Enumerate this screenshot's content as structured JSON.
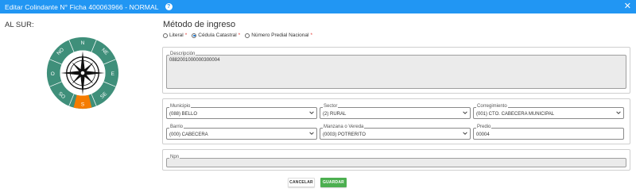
{
  "window": {
    "title": "Editar Colindante N° Ficha 400063966 - NORMAL",
    "help_icon": "?",
    "close_icon": "✕"
  },
  "side": {
    "label": "AL SUR:",
    "compass": {
      "n": "N",
      "ne": "NE",
      "e": "E",
      "se": "SE",
      "s": "S",
      "so": "SO",
      "o": "O",
      "no": "NO",
      "selected": "S"
    }
  },
  "method": {
    "title": "Método de ingreso",
    "options": [
      {
        "label": "Literal",
        "required": "*",
        "selected": false
      },
      {
        "label": "Cédula Catastral",
        "required": "*",
        "selected": true
      },
      {
        "label": "Número Predial Nacional",
        "required": "*",
        "selected": false
      }
    ]
  },
  "descripcion": {
    "label": "Descripción",
    "value": "0882001000000300004"
  },
  "fields": {
    "municipio": {
      "label": "Municipio",
      "value": "(088) BELLO"
    },
    "sector": {
      "label": "Sector",
      "value": "(2) RURAL"
    },
    "corregimiento": {
      "label": "Corregimiento",
      "value": "(001) CTO. CABECERA MUNICIPAL"
    },
    "barrio": {
      "label": "Barrio",
      "value": "(000) CABECERA"
    },
    "manzana": {
      "label": "Manzana o Vereda",
      "value": "(0003) POTRERITO"
    },
    "predio": {
      "label": "Predio",
      "value": "00004"
    }
  },
  "npn": {
    "label": "Npn",
    "value": ""
  },
  "actions": {
    "cancel": "CANCELAR",
    "save": "GUARDAR"
  },
  "colors": {
    "titlebar": "#2196f3",
    "accent": "#1976d2",
    "compass_ring": "#3f8f7a",
    "compass_selected": "#f57c00",
    "save": "#4caf50"
  }
}
